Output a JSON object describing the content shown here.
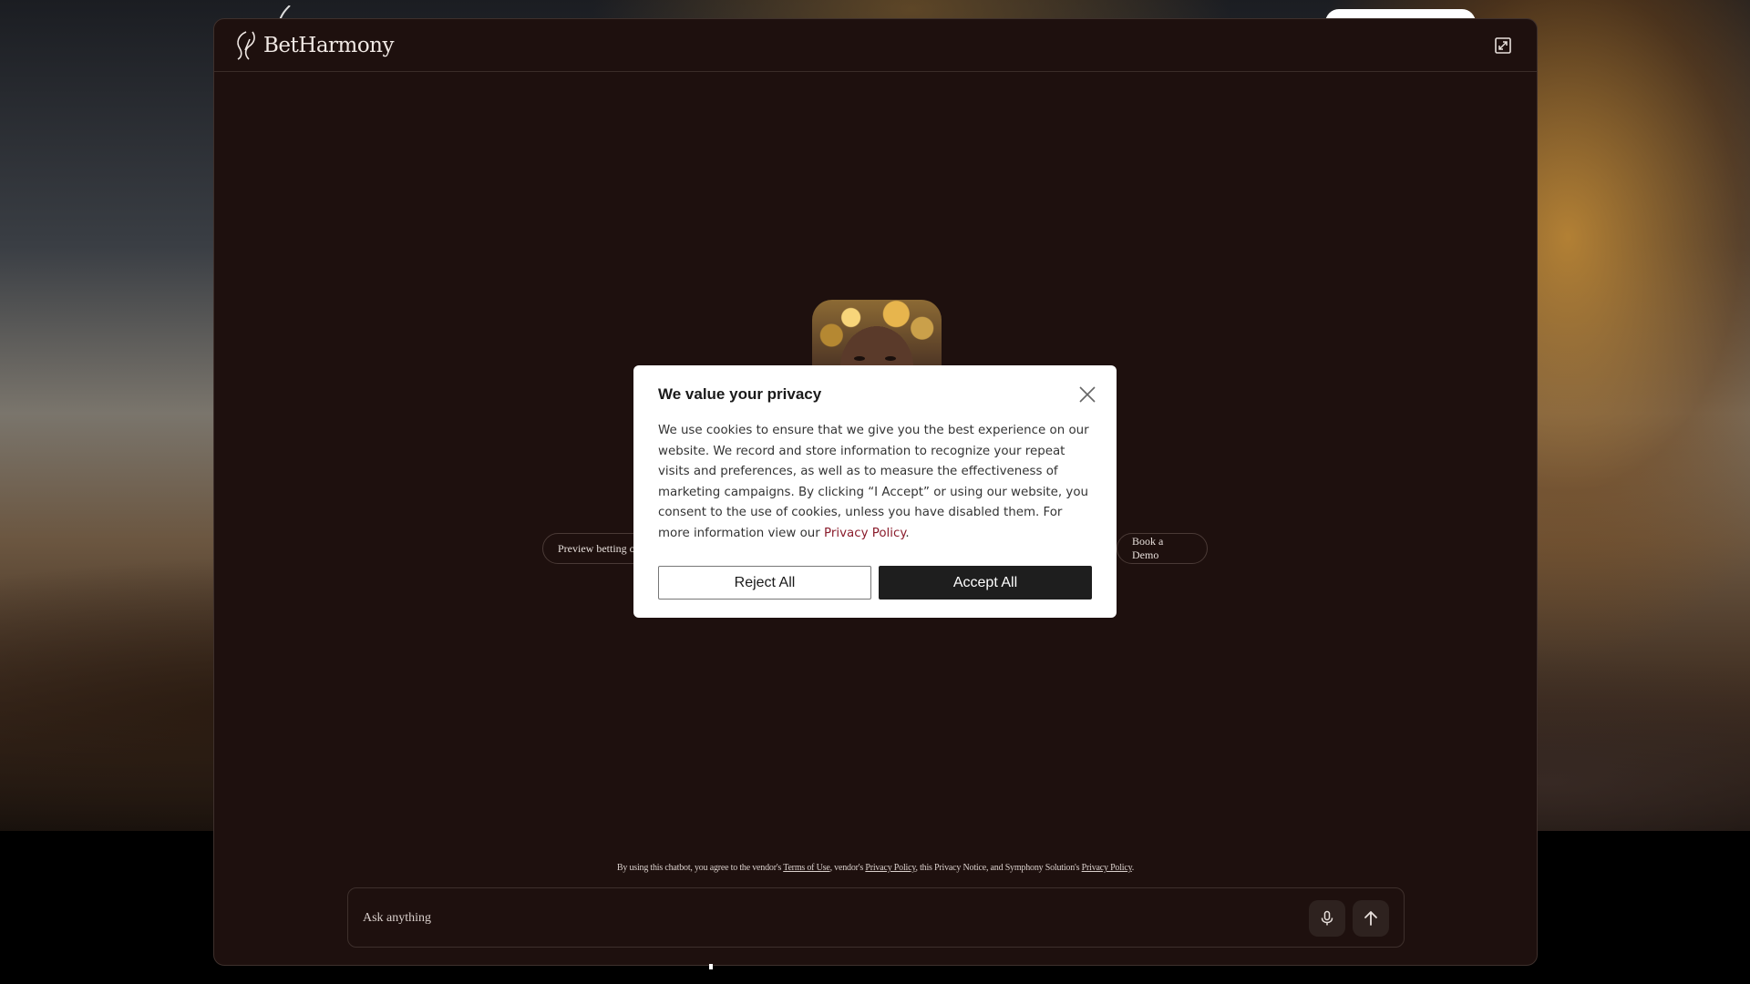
{
  "chat": {
    "brand_name": "BetHarmony",
    "chips": {
      "preview": "Preview betting o",
      "demo": "Book a Demo"
    },
    "disclaimer": {
      "prefix": "By using this chatbot, you agree to the vendor's ",
      "terms_link": "Terms of Use",
      "mid1": ", vendor's ",
      "vendor_privacy_link": "Privacy Policy",
      "mid2": ", this Privacy Notice, and Symphony Solution's ",
      "symphony_privacy_link": "Privacy Policy",
      "suffix": "."
    },
    "input": {
      "placeholder": "Ask anything"
    }
  },
  "cookie_modal": {
    "title": "We value your privacy",
    "body": "We use cookies to ensure that we give you the best experience on our website. We record and store information to recognize your repeat visits and preferences, as well as to measure the effectiveness of marketing campaigns. By clicking “I Accept” or using our website, you consent to the use of cookies, unless you have disabled them. For more information view our ",
    "privacy_link": "Privacy Policy",
    "body_end": ".",
    "reject_label": "Reject All",
    "accept_label": "Accept All"
  },
  "colors": {
    "chat_bg": "#1e100e",
    "accept_bg": "#1e1e1e",
    "link_accent": "#8a1c2c"
  },
  "icons": {
    "brand": "betharmony-logo-icon",
    "expand": "expand-icon",
    "close": "close-icon",
    "mic": "microphone-icon",
    "send": "arrow-up-icon"
  }
}
